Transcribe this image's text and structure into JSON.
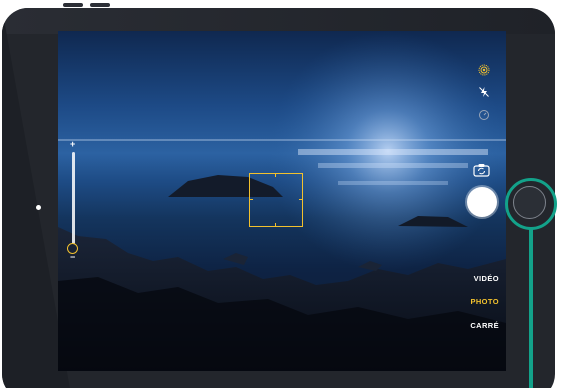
{
  "camera": {
    "exposure": {
      "plus": "+",
      "minus": "−",
      "level": 0.0
    },
    "top_icons": [
      "live-photo-icon",
      "flash-off-icon",
      "timer-icon"
    ],
    "switch_camera_icon": "camera-switch-icon",
    "modes": [
      {
        "label": "VIDÉO",
        "active": false
      },
      {
        "label": "PHOTO",
        "active": true
      },
      {
        "label": "CARRÉ",
        "active": false
      }
    ],
    "colors": {
      "accent": "#f2c12e",
      "callout": "#13a28a",
      "device": "#23262c"
    }
  },
  "device": {
    "home_button_highlighted": true
  }
}
